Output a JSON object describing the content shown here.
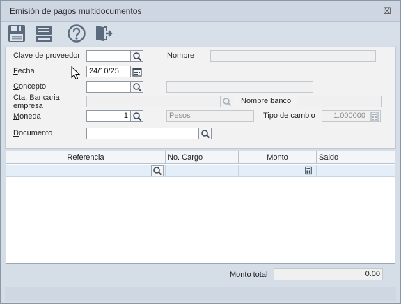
{
  "window": {
    "title": "Emisión de pagos multidocumentos",
    "close_glyph": "☒"
  },
  "toolbar": {
    "buttons": [
      {
        "name": "save-icon",
        "tooltip": "Guardar"
      },
      {
        "name": "print-icon",
        "tooltip": "Imprimir"
      },
      {
        "name": "help-icon",
        "tooltip": "Ayuda"
      },
      {
        "name": "exit-icon",
        "tooltip": "Salir"
      }
    ]
  },
  "form": {
    "clave_proveedor": {
      "label_pre": "Clave de ",
      "label_key": "p",
      "label_post": "roveedor",
      "value": ""
    },
    "nombre": {
      "label": "Nombre",
      "value": ""
    },
    "fecha": {
      "label_key": "F",
      "label_post": "echa",
      "value": "24/10/25"
    },
    "concepto": {
      "label_key": "C",
      "label_post": "oncepto",
      "value": "",
      "extra_value": ""
    },
    "cta_bancaria": {
      "label_line1": "Cta. Bancaria",
      "label_line2": "empresa",
      "value": ""
    },
    "nombre_banco": {
      "label": "Nombre banco",
      "value": ""
    },
    "moneda": {
      "label_key": "M",
      "label_post": "oneda",
      "value": "1",
      "desc": "Pesos"
    },
    "tipo_cambio": {
      "label_key": "T",
      "label_post": "ipo de cambio",
      "value": "1.000000"
    },
    "documento": {
      "label_key": "D",
      "label_post": "ocumento",
      "value": ""
    }
  },
  "grid": {
    "columns": [
      "Referencia",
      "No. Cargo",
      "Monto",
      "Saldo"
    ]
  },
  "footer": {
    "monto_total_label": "Monto total",
    "monto_total_value": "0.00"
  },
  "colors": {
    "accent": "#2a6bb3",
    "grid_row": "#e4eef8"
  }
}
